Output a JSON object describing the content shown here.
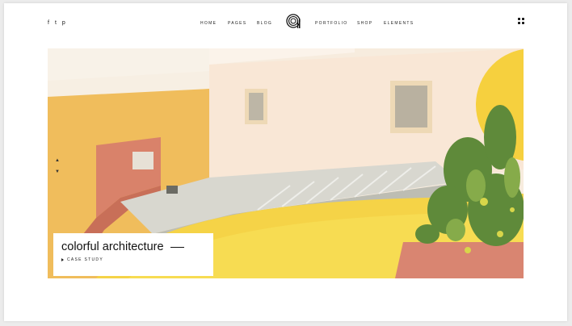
{
  "social": {
    "facebook_icon": "f",
    "twitter_icon": "t",
    "pinterest_icon": "p"
  },
  "nav": {
    "left": [
      "HOME",
      "PAGES",
      "BLOG"
    ],
    "right": [
      "PORTFOLIO",
      "SHOP",
      "ELEMENTS"
    ]
  },
  "hero": {
    "arrow_up": "▲",
    "arrow_down": "▼",
    "title": "colorful architecture",
    "link": "CASE STUDY"
  },
  "colors": {
    "sand": "#f2c05a",
    "terracotta": "#d9826a",
    "yellow": "#f6d44a",
    "white_wall": "#f8eadb",
    "step_grey": "#bdbdb3",
    "plant_green": "#5f8a3a"
  }
}
